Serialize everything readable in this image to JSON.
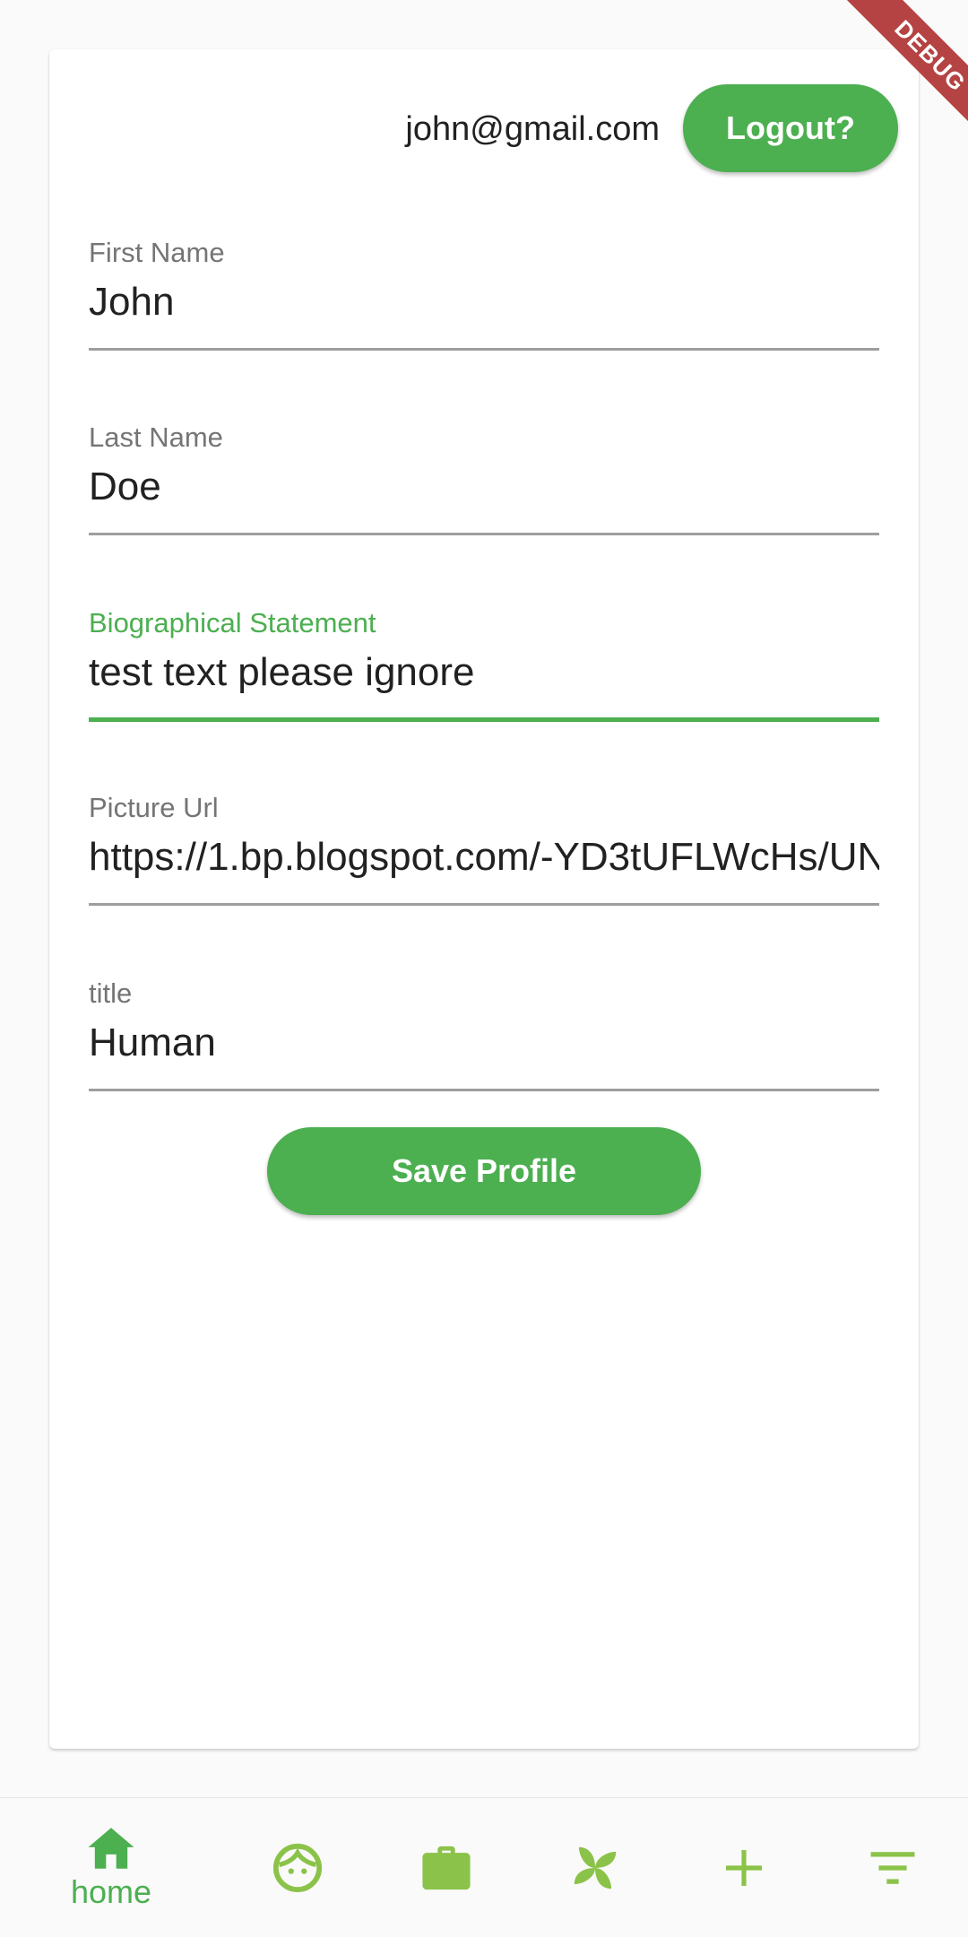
{
  "header": {
    "email": "john@gmail.com",
    "logout_label": "Logout?"
  },
  "form": {
    "fields": [
      {
        "label": "First Name",
        "value": "John"
      },
      {
        "label": "Last Name",
        "value": "Doe"
      },
      {
        "label": "Biographical Statement",
        "value": "test text please ignore"
      },
      {
        "label": "Picture Url",
        "value": "https://1.bp.blogspot.com/-YD3tUFLWcHs/UN"
      },
      {
        "label": "title",
        "value": "Human"
      }
    ],
    "focused_field": "Biographical Statement",
    "save_label": "Save Profile"
  },
  "debug_banner": "DEBUG",
  "bottom_nav": {
    "items": [
      {
        "icon": "home-icon",
        "label": "home",
        "selected": true
      },
      {
        "icon": "face-icon"
      },
      {
        "icon": "briefcase-icon"
      },
      {
        "icon": "pinwheel-icon"
      },
      {
        "icon": "add-icon"
      },
      {
        "icon": "filter-icon"
      }
    ]
  },
  "colors": {
    "accent": "#4caf50",
    "nav_icon": "#8bc34a",
    "debug_ribbon": "#b33a3a"
  }
}
